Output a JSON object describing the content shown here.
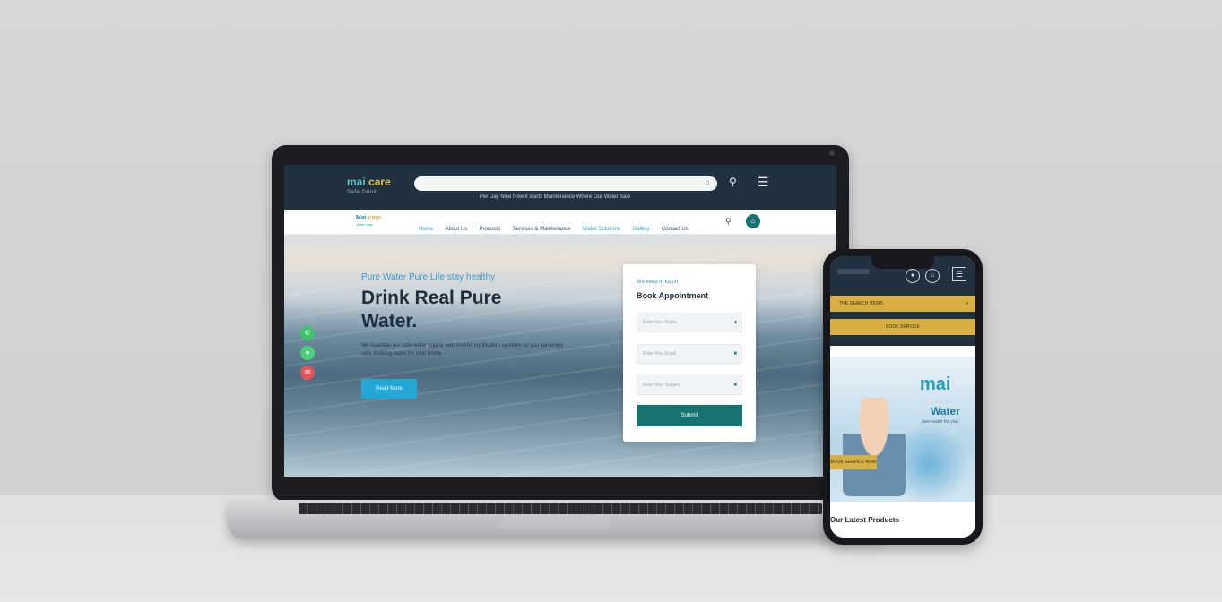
{
  "desktop": {
    "topbar": {
      "brand": "mai",
      "brand_accent": "care",
      "brand_tagline": "Safe Drink",
      "search_placeholder": "",
      "links": "Per Day Nice  Now it starts  Maintenance  Where  Our Water  Sale"
    },
    "navbar": {
      "logo_main": "Mai",
      "logo_accent": "care",
      "logo_tagline": "Water care",
      "items": [
        "Home",
        "About Us",
        "Products",
        "Services & Maintenance",
        "Water Solutions",
        "Gallery",
        "Contact Us"
      ]
    },
    "hero": {
      "kicker": "Pure Water Pure Life stay healthy",
      "title": "Drink Real Pure Water.",
      "description": "We maintain our safe water supply with trusted purification systems so you can enjoy safe drinking water for your home.",
      "button": "Read More"
    },
    "appointment": {
      "kicker": "We keep in touch",
      "title": "Book Appointment",
      "field_name": "Enter Your Name",
      "field_email": "Enter Your Email",
      "field_subject": "Enter Your Subject",
      "submit": "Submit"
    }
  },
  "mobile": {
    "bar1": "THE SEARCH ITEMS",
    "bar2": "BOOK SERVICE",
    "hero_title": "mai",
    "hero_subtitle": "Water",
    "hero_desc": "pure water for you",
    "hero_button": "BOOK SERVICE NOW",
    "latest": "Our Latest Products"
  },
  "colors": {
    "dark_header": "#213140",
    "accent_teal": "#17736f",
    "accent_blue": "#22a7d6",
    "accent_gold": "#d6b042"
  }
}
